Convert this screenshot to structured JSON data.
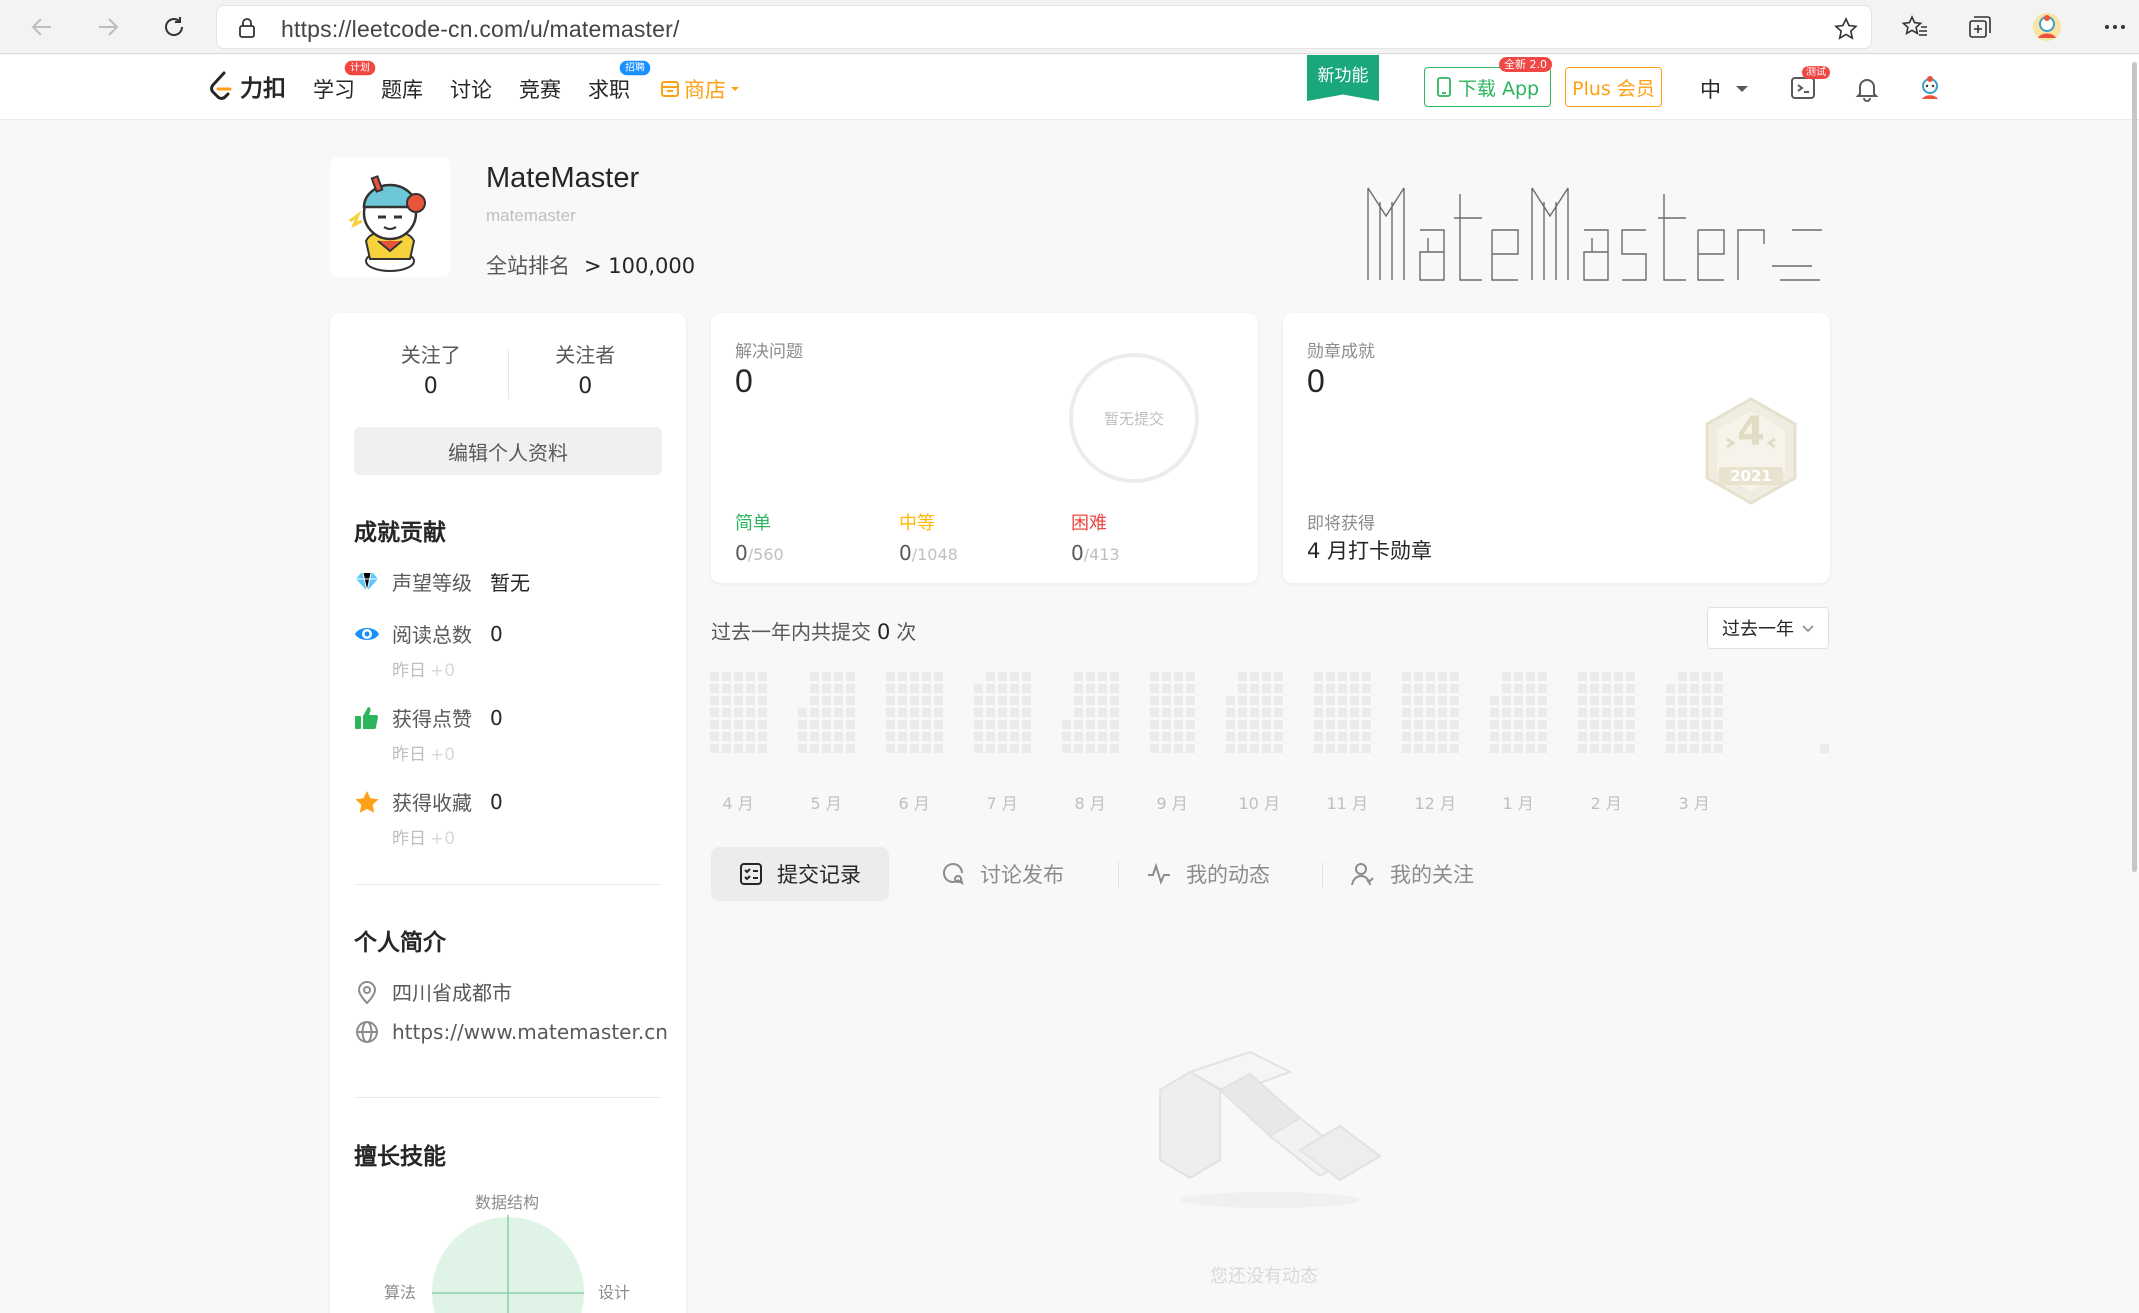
{
  "browser": {
    "url": "https://leetcode-cn.com/u/matemaster/"
  },
  "header": {
    "logo_text": "力扣",
    "nav": [
      {
        "label": "学习",
        "badge": "计划"
      },
      {
        "label": "题库"
      },
      {
        "label": "讨论"
      },
      {
        "label": "竞赛"
      },
      {
        "label": "求职",
        "badge": "招聘"
      }
    ],
    "store_label": "商店",
    "new_feature": "新功能",
    "download_label": "下载 App",
    "download_tag": "全新 2.0",
    "plus_label": "Plus 会员",
    "lang": "中",
    "playground_tag": "测试"
  },
  "profile": {
    "name": "MateMaster",
    "username": "matemaster",
    "rank_label": "全站排名",
    "rank_value": "> 100,000"
  },
  "follow": {
    "following_label": "关注了",
    "following_value": "0",
    "followers_label": "关注者",
    "followers_value": "0",
    "edit_label": "编辑个人资料"
  },
  "contributions": {
    "title": "成就贡献",
    "reputation_label": "声望等级",
    "reputation_value": "暂无",
    "items": [
      {
        "label": "阅读总数",
        "value": "0",
        "yesterday": "昨日",
        "delta": "+0"
      },
      {
        "label": "获得点赞",
        "value": "0",
        "yesterday": "昨日",
        "delta": "+0"
      },
      {
        "label": "获得收藏",
        "value": "0",
        "yesterday": "昨日",
        "delta": "+0"
      }
    ]
  },
  "bio": {
    "title": "个人简介",
    "location": "四川省成都市",
    "website": "https://www.matemaster.cn"
  },
  "skills": {
    "title": "擅长技能",
    "axes": [
      "数据结构",
      "算法",
      "设计"
    ]
  },
  "solved": {
    "label": "解决问题",
    "value": "0",
    "circle_text": "暂无提交",
    "easy_label": "简单",
    "easy_solved": "0",
    "easy_total": "/560",
    "medium_label": "中等",
    "medium_solved": "0",
    "medium_total": "/1048",
    "hard_label": "困难",
    "hard_solved": "0",
    "hard_total": "/413",
    "colors": {
      "easy": "#2db55d",
      "medium": "#ffb800",
      "hard": "#ef4743"
    }
  },
  "badges": {
    "label": "勋章成就",
    "value": "0",
    "badge_number": "4",
    "badge_year": "2021",
    "upcoming_label": "即将获得",
    "upcoming_value": "4 月打卡勋章"
  },
  "submissions": {
    "summary_prefix": "过去一年内共提交",
    "count": "0",
    "summary_suffix": "次",
    "range": "过去一年",
    "months": [
      "4 月",
      "5 月",
      "6 月",
      "7 月",
      "8 月",
      "9 月",
      "10 月",
      "11 月",
      "12 月",
      "1 月",
      "2 月",
      "3 月"
    ]
  },
  "tabs": [
    {
      "label": "提交记录",
      "active": true
    },
    {
      "label": "讨论发布",
      "active": false
    },
    {
      "label": "我的动态",
      "active": false
    },
    {
      "label": "我的关注",
      "active": false
    }
  ],
  "empty": {
    "text": "您还没有动态"
  }
}
